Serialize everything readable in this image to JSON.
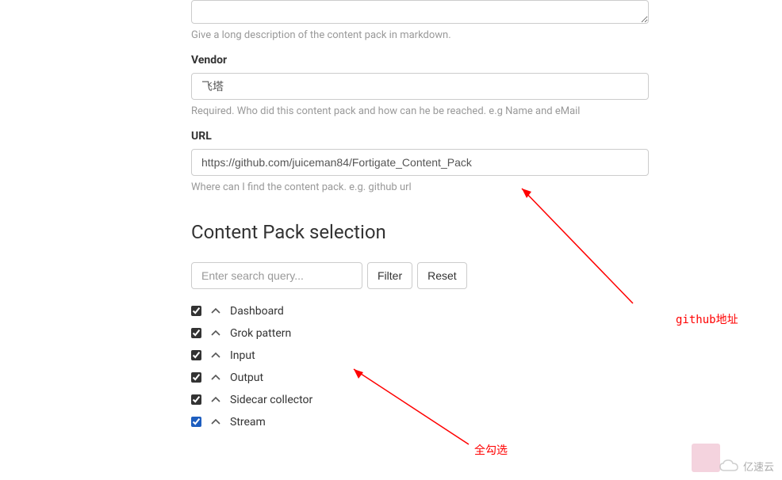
{
  "description": {
    "value": "",
    "help": "Give a long description of the content pack in markdown."
  },
  "vendor": {
    "label": "Vendor",
    "value": "飞塔",
    "help": "Required. Who did this content pack and how can he be reached. e.g Name and eMail"
  },
  "url": {
    "label": "URL",
    "value": "https://github.com/juiceman84/Fortigate_Content_Pack",
    "help": "Where can I find the content pack. e.g. github url"
  },
  "selection": {
    "heading": "Content Pack selection",
    "search_placeholder": "Enter search query...",
    "filter_label": "Filter",
    "reset_label": "Reset",
    "items": [
      {
        "label": "Dashboard",
        "checked": true
      },
      {
        "label": "Grok pattern",
        "checked": true
      },
      {
        "label": "Input",
        "checked": true
      },
      {
        "label": "Output",
        "checked": true
      },
      {
        "label": "Sidecar collector",
        "checked": true
      },
      {
        "label": "Stream",
        "checked": true
      }
    ]
  },
  "annotations": {
    "github": "github地址",
    "select_all": "全勾选"
  },
  "logo": {
    "text": "亿速云"
  }
}
